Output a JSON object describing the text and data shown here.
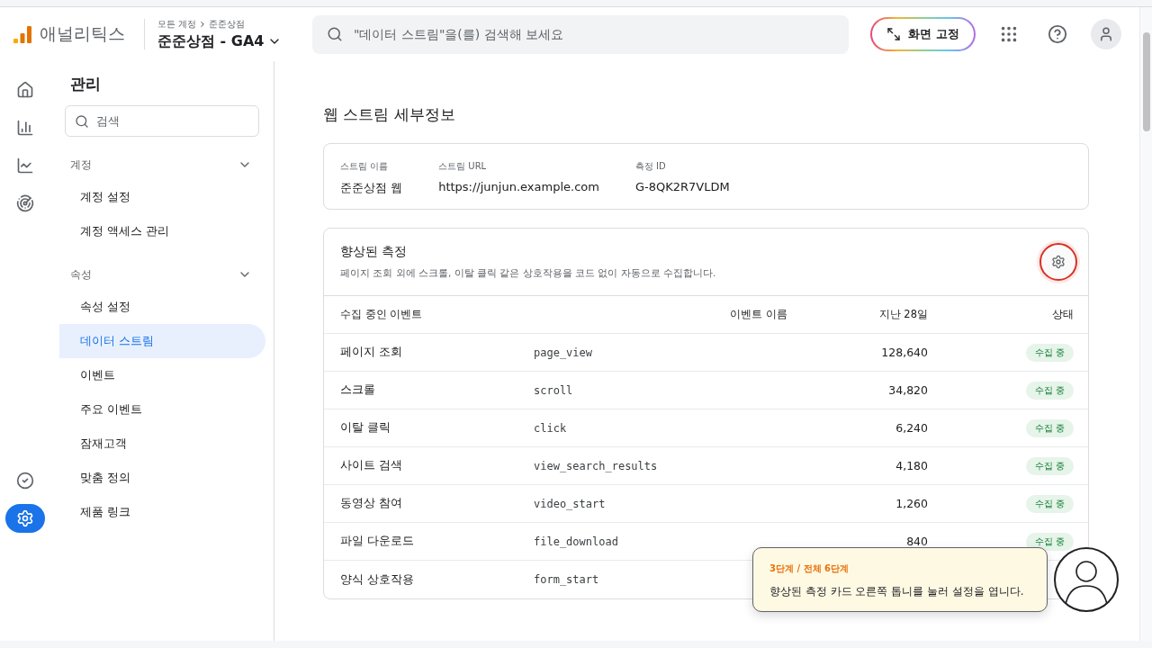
{
  "app": {
    "name": "애널리틱스"
  },
  "breadcrumb": {
    "items": [
      "모든 계정",
      "준준상점"
    ],
    "property": "준준상점 - GA4"
  },
  "search": {
    "placeholder": "\"데이터 스트림\"을(를) 검색해 보세요"
  },
  "pin_button": {
    "label": "화면 고정"
  },
  "rail": [
    {
      "kind": "home",
      "selected": false
    },
    {
      "kind": "reports",
      "selected": false
    },
    {
      "kind": "explore",
      "selected": false
    },
    {
      "kind": "advertising",
      "selected": false
    }
  ],
  "rail_bottom": [
    {
      "kind": "check",
      "selected": false
    },
    {
      "kind": "admin",
      "selected": true
    }
  ],
  "sidebar": {
    "title": "관리",
    "search_placeholder": "검색",
    "sections": [
      {
        "title": "계정",
        "expanded": true,
        "items": [
          {
            "label": "계정 설정",
            "selected": false
          },
          {
            "label": "계정 액세스 관리",
            "selected": false
          }
        ]
      },
      {
        "title": "속성",
        "expanded": true,
        "items": [
          {
            "label": "속성 설정",
            "selected": false
          },
          {
            "label": "데이터 스트림",
            "selected": true
          },
          {
            "label": "이벤트",
            "selected": false
          },
          {
            "label": "주요 이벤트",
            "selected": false
          },
          {
            "label": "잠재고객",
            "selected": false
          },
          {
            "label": "맞춤 정의",
            "selected": false
          },
          {
            "label": "제품 링크",
            "selected": false
          }
        ]
      }
    ]
  },
  "page_title": "웹 스트림 세부정보",
  "stream_info": [
    {
      "label": "스트림 이름",
      "value": "준준상점 웹"
    },
    {
      "label": "스트림 URL",
      "value": "https://junjun.example.com"
    },
    {
      "label": "측정 ID",
      "value": "G-8QK2R7VLDM"
    }
  ],
  "enhanced": {
    "title": "향상된 측정",
    "description": "페이지 조회 외에 스크롤, 이탈 클릭 같은 상호작용을 코드 없이 자동으로 수집합니다.",
    "settings_highlighted": true,
    "columns": [
      "수집 중인 이벤트",
      "이벤트 이름",
      "지난 28일",
      "상태"
    ],
    "rows": [
      {
        "name": "페이지 조회",
        "event": "page_view",
        "count": "128,640",
        "status": "수집 중"
      },
      {
        "name": "스크롤",
        "event": "scroll",
        "count": "34,820",
        "status": "수집 중"
      },
      {
        "name": "이탈 클릭",
        "event": "click",
        "count": "6,240",
        "status": "수집 중"
      },
      {
        "name": "사이트 검색",
        "event": "view_search_results",
        "count": "4,180",
        "status": "수집 중"
      },
      {
        "name": "동영상 참여",
        "event": "video_start",
        "count": "1,260",
        "status": "수집 중"
      },
      {
        "name": "파일 다운로드",
        "event": "file_download",
        "count": "840",
        "status": "수집 중"
      },
      {
        "name": "양식 상호작용",
        "event": "form_start"
      }
    ]
  },
  "guide": {
    "step": "3단계 / 전체 6단계",
    "message": "향상된 측정 카드 오른쪽 톱니를 눌러 설정을 엽니다."
  }
}
